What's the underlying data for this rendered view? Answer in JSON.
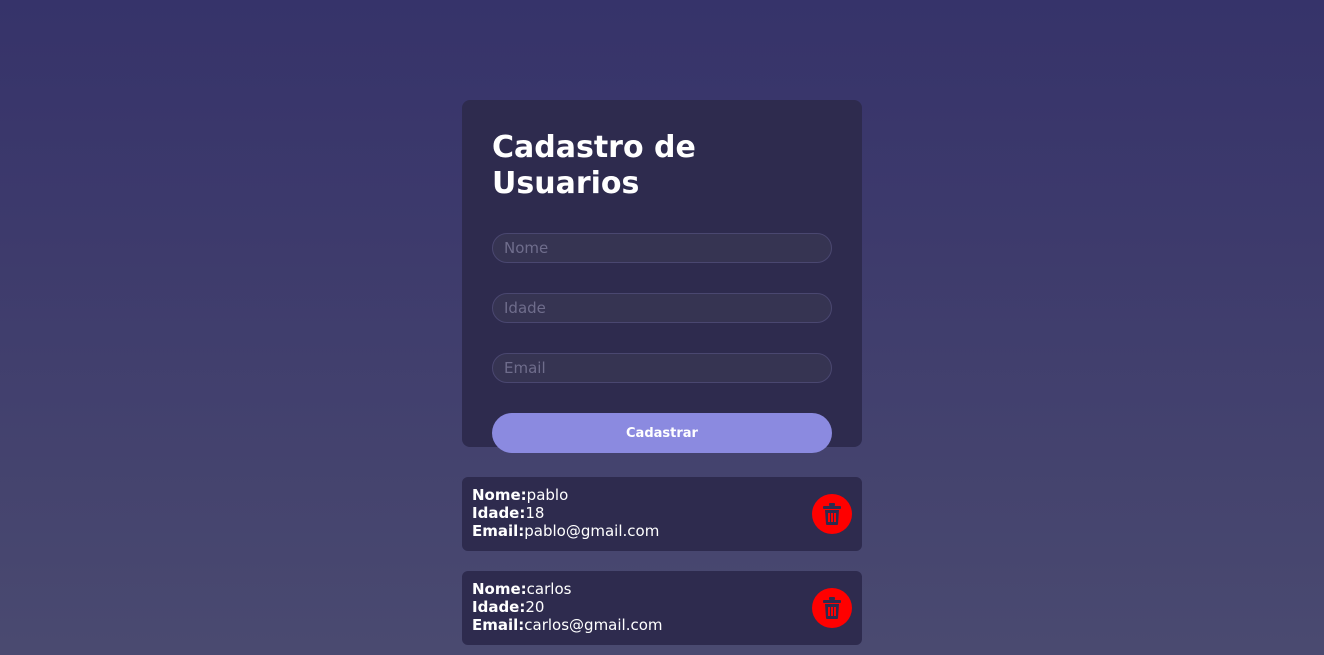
{
  "form": {
    "title": "Cadastro de Usuarios",
    "fields": {
      "nome_placeholder": "Nome",
      "idade_placeholder": "Idade",
      "email_placeholder": "Email",
      "nome_value": "",
      "idade_value": "",
      "email_value": ""
    },
    "submit_label": "Cadastrar"
  },
  "labels": {
    "nome": "Nome:",
    "idade": "Idade:",
    "email": "Email:"
  },
  "users": [
    {
      "nome": "pablo",
      "idade": "18",
      "email": "pablo@gmail.com",
      "delete_icon": "trash-icon"
    },
    {
      "nome": "carlos",
      "idade": "20",
      "email": "carlos@gmail.com",
      "delete_icon": "trash-icon"
    }
  ],
  "colors": {
    "card": "#2e2b4e",
    "button": "#8b8ae0",
    "delete": "#ff0000"
  }
}
